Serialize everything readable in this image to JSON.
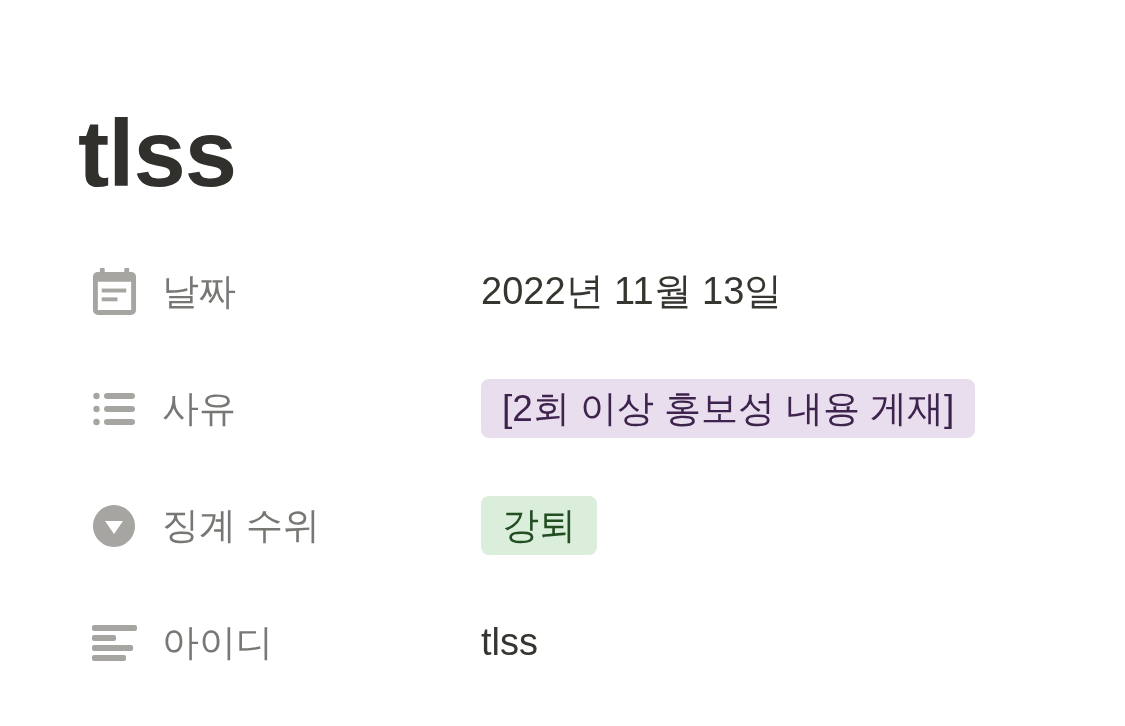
{
  "page": {
    "title": "tlss",
    "properties": [
      {
        "kind": "date",
        "name": "날짜",
        "value": "2022년 11월 13일"
      },
      {
        "kind": "multi_select",
        "name": "사유",
        "tags": [
          {
            "label": "[2회 이상 홍보성 내용 게재]",
            "color": "#e8deee"
          }
        ]
      },
      {
        "kind": "select",
        "name": "징계 수위",
        "tags": [
          {
            "label": "강퇴",
            "color": "#dbeddb"
          }
        ]
      },
      {
        "kind": "text",
        "name": "아이디",
        "value": "tlss"
      }
    ]
  }
}
